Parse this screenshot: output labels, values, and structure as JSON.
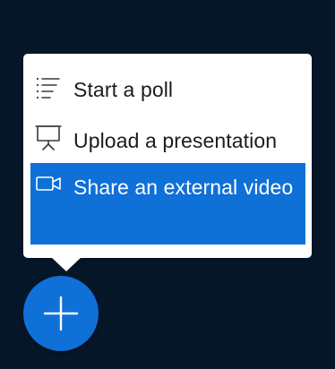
{
  "actions_menu": {
    "items": [
      {
        "label": "Start a poll",
        "icon": "poll-list-icon"
      },
      {
        "label": "Upload a presentation",
        "icon": "presentation-icon"
      },
      {
        "label": "Share an external video",
        "icon": "video-camera-icon",
        "selected": true
      }
    ]
  },
  "fab": {
    "icon": "plus-icon"
  },
  "colors": {
    "background": "#06172a",
    "accent": "#0f70d7",
    "menu_background": "#ffffff",
    "text": "#1c1c1c",
    "selected_text": "#ffffff"
  }
}
